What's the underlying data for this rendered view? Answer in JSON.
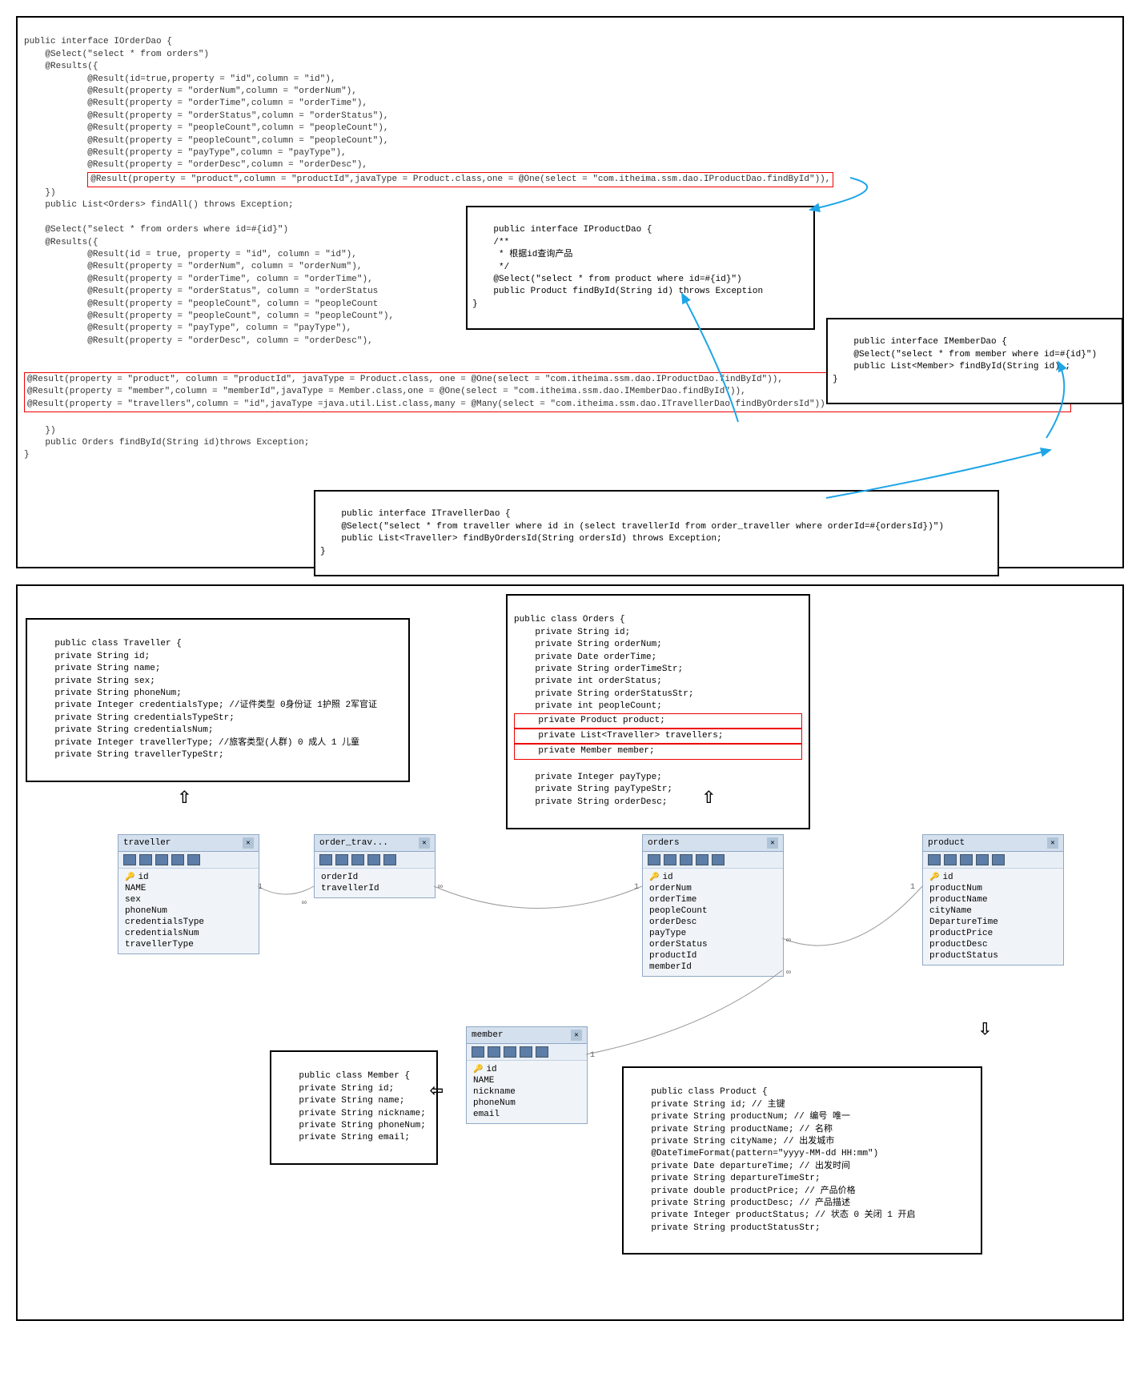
{
  "top_panel": {
    "interface_line": "public interface IOrderDao {",
    "select_all": "    @Select(\"select * from orders\")",
    "results_open": "    @Results({",
    "r1": "            @Result(id=true,property = \"id\",column = \"id\"),",
    "r2": "            @Result(property = \"orderNum\",column = \"orderNum\"),",
    "r3": "            @Result(property = \"orderTime\",column = \"orderTime\"),",
    "r4": "            @Result(property = \"orderStatus\",column = \"orderStatus\"),",
    "r5": "            @Result(property = \"peopleCount\",column = \"peopleCount\"),",
    "r6": "            @Result(property = \"peopleCount\",column = \"peopleCount\"),",
    "r7": "            @Result(property = \"payType\",column = \"payType\"),",
    "r8": "            @Result(property = \"orderDesc\",column = \"orderDesc\"),",
    "r9_boxed": "@Result(property = \"product\",column = \"productId\",javaType = Product.class,one = @One(select = \"com.itheima.ssm.dao.IProductDao.findById\")),",
    "results_close": "    })",
    "find_all": "    public List<Orders> findAll() throws Exception;",
    "select_byid": "    @Select(\"select * from orders where id=#{id}\")",
    "results2_open": "    @Results({",
    "s1": "            @Result(id = true, property = \"id\", column = \"id\"),",
    "s2": "            @Result(property = \"orderNum\", column = \"orderNum\"),",
    "s3": "            @Result(property = \"orderTime\", column = \"orderTime\"),",
    "s4": "            @Result(property = \"orderStatus\", column = \"orderStatus",
    "s5": "            @Result(property = \"peopleCount\", column = \"peopleCount",
    "s6": "            @Result(property = \"peopleCount\", column = \"peopleCount\"),",
    "s7": "            @Result(property = \"payType\", column = \"payType\"),",
    "s8": "            @Result(property = \"orderDesc\", column = \"orderDesc\"),",
    "box2_l1": "@Result(property = \"product\", column = \"productId\", javaType = Product.class, one = @One(select = \"com.itheima.ssm.dao.IProductDao.findById\")),",
    "box2_l2": "@Result(property = \"member\",column = \"memberId\",javaType = Member.class,one = @One(select = \"com.itheima.ssm.dao.IMemberDao.findById\")),",
    "box2_l3": "@Result(property = \"travellers\",column = \"id\",javaType =java.util.List.class,many = @Many(select = \"com.itheima.ssm.dao.ITravellerDao.findByOrdersId\"))",
    "results2_close": "    })",
    "find_byid": "    public Orders findById(String id)throws Exception;",
    "close_brace": "}",
    "iproduct": "public interface IProductDao {\n    /**\n     * 根据id查询产品\n     */\n    @Select(\"select * from product where id=#{id}\")\n    public Product findById(String id) throws Exception\n}",
    "imember": "public interface IMemberDao {\n    @Select(\"select * from member where id=#{id}\")\n    public List<Member> findById(String id) ;\n}",
    "itraveller": "public interface ITravellerDao {\n    @Select(\"select * from traveller where id in (select travellerId from order_traveller where orderId=#{ordersId})\")\n    public List<Traveller> findByOrdersId(String ordersId) throws Exception;\n}"
  },
  "bottom_panel": {
    "traveller_cls": "public class Traveller {\n    private String id;\n    private String name;\n    private String sex;\n    private String phoneNum;\n    private Integer credentialsType; //证件类型 0身份证 1护照 2军官证\n    private String credentialsTypeStr;\n    private String credentialsNum;\n    private Integer travellerType; //旅客类型(人群) 0 成人 1 儿童\n    private String travellerTypeStr;",
    "orders_cls_top": "public class Orders {\n    private String id;\n    private String orderNum;\n    private Date orderTime;\n    private String orderTimeStr;\n    private int orderStatus;\n    private String orderStatusStr;\n    private int peopleCount;",
    "orders_boxed1": "    private Product product;",
    "orders_boxed2": "    private List<Traveller> travellers;",
    "orders_boxed3": "    private Member member;",
    "orders_cls_bot": "    private Integer payType;\n    private String payTypeStr;\n    private String orderDesc;",
    "member_cls": "public class Member {\n    private String id;\n    private String name;\n    private String nickname;\n    private String phoneNum;\n    private String email;",
    "product_cls": "public class Product {\n    private String id; // 主键\n    private String productNum; // 编号 唯一\n    private String productName; // 名称\n    private String cityName; // 出发城市\n    @DateTimeFormat(pattern=\"yyyy-MM-dd HH:mm\")\n    private Date departureTime; // 出发时间\n    private String departureTimeStr;\n    private double productPrice; // 产品价格\n    private String productDesc; // 产品描述\n    private Integer productStatus; // 状态 0 关闭 1 开启\n    private String productStatusStr;",
    "tables": {
      "traveller": {
        "name": "traveller",
        "cols": [
          "id",
          "NAME",
          "sex",
          "phoneNum",
          "credentialsType",
          "credentialsNum",
          "travellerType"
        ],
        "key": 0
      },
      "order_trav": {
        "name": "order_trav...",
        "cols": [
          "orderId",
          "travellerId"
        ],
        "key": -1
      },
      "orders": {
        "name": "orders",
        "cols": [
          "id",
          "orderNum",
          "orderTime",
          "peopleCount",
          "orderDesc",
          "payType",
          "orderStatus",
          "productId",
          "memberId"
        ],
        "key": 0
      },
      "product": {
        "name": "product",
        "cols": [
          "id",
          "productNum",
          "productName",
          "cityName",
          "DepartureTime",
          "productPrice",
          "productDesc",
          "productStatus"
        ],
        "key": 0
      },
      "member": {
        "name": "member",
        "cols": [
          "id",
          "NAME",
          "nickname",
          "phoneNum",
          "email"
        ],
        "key": 0
      }
    }
  }
}
